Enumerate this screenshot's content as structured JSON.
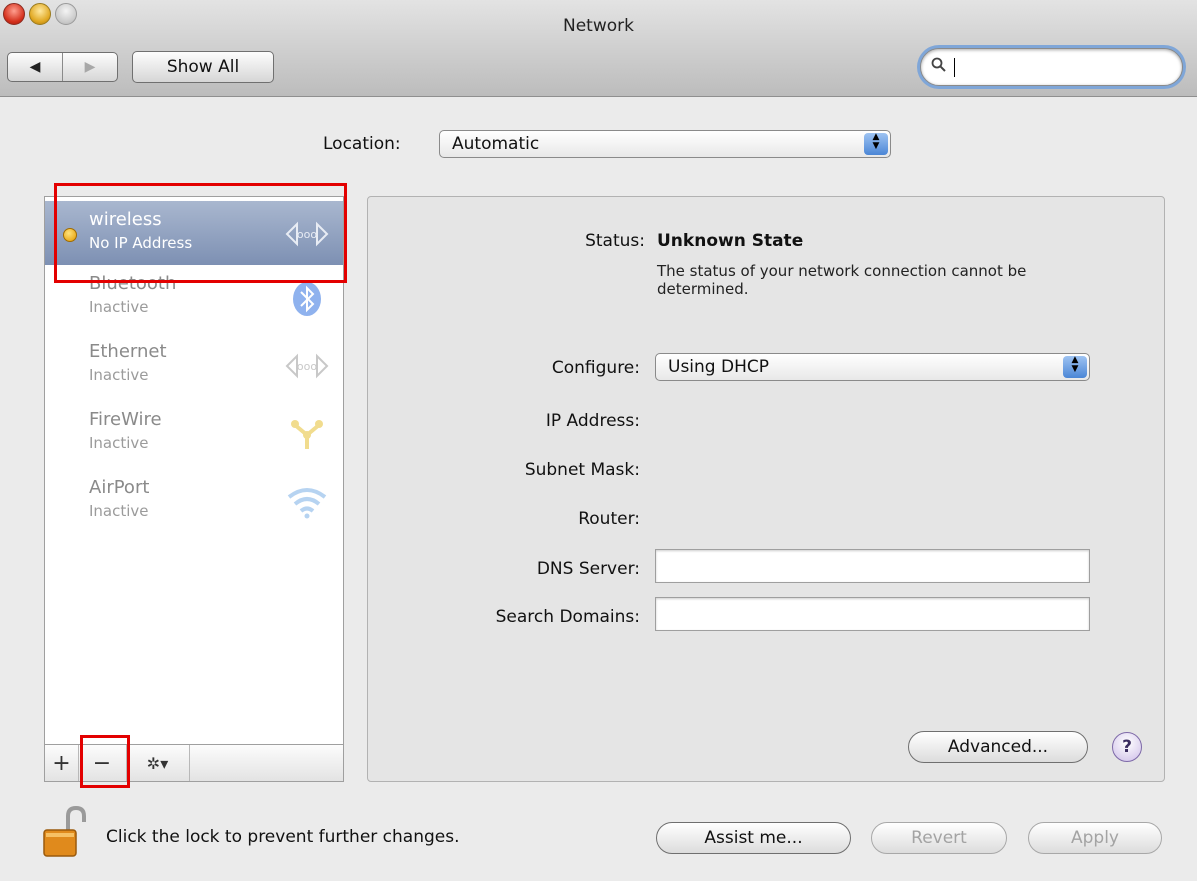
{
  "window": {
    "title": "Network",
    "nav": {
      "back": "◀",
      "forward": "▶"
    },
    "show_all": "Show All",
    "search_placeholder": ""
  },
  "location": {
    "label": "Location:",
    "value": "Automatic"
  },
  "services": [
    {
      "name": "wireless",
      "status": "No IP Address",
      "selected": true,
      "icon": "ethernet-arrows-icon"
    },
    {
      "name": "Bluetooth",
      "status": "Inactive",
      "icon": "bluetooth-icon"
    },
    {
      "name": "Ethernet",
      "status": "Inactive",
      "icon": "ethernet-arrows-icon"
    },
    {
      "name": "FireWire",
      "status": "Inactive",
      "icon": "firewire-icon"
    },
    {
      "name": "AirPort",
      "status": "Inactive",
      "icon": "wifi-icon"
    }
  ],
  "list_toolbar": {
    "add": "+",
    "remove": "−",
    "gear": "✲▾"
  },
  "detail": {
    "status_label": "Status:",
    "status_value": "Unknown State",
    "status_desc": "The status of your network connection cannot be determined.",
    "configure_label": "Configure:",
    "configure_value": "Using DHCP",
    "ip_label": "IP Address:",
    "subnet_label": "Subnet Mask:",
    "router_label": "Router:",
    "dns_label": "DNS Server:",
    "search_domains_label": "Search Domains:",
    "advanced_button": "Advanced...",
    "help": "?"
  },
  "footer": {
    "lock_text": "Click the lock to prevent further changes.",
    "assist": "Assist me...",
    "revert": "Revert",
    "apply": "Apply"
  },
  "highlight_color": "#e30000"
}
